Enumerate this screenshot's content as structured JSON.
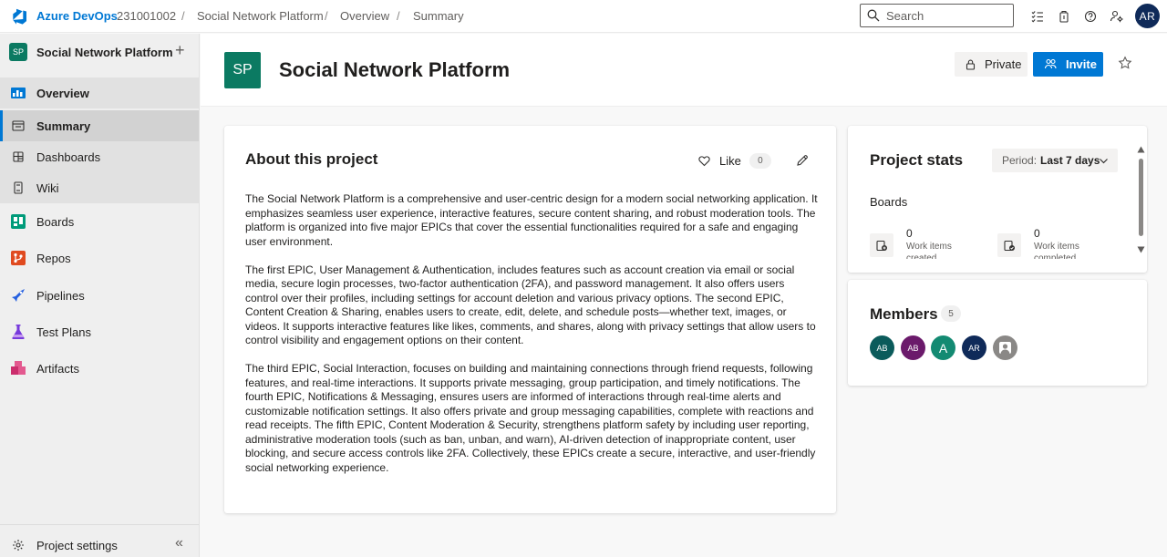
{
  "topbar": {
    "brand": "Azure DevOps",
    "crumbs": [
      "231001002",
      "Social Network Platform",
      "Overview",
      "Summary"
    ],
    "separator": "/",
    "search_placeholder": "Search",
    "user_initials": "AR"
  },
  "sidebar": {
    "project_initials": "SP",
    "project_name": "Social Network Platform",
    "add_symbol": "+",
    "items": [
      {
        "label": "Overview"
      },
      {
        "label": "Summary"
      },
      {
        "label": "Dashboards"
      },
      {
        "label": "Wiki"
      },
      {
        "label": "Boards"
      },
      {
        "label": "Repos"
      },
      {
        "label": "Pipelines"
      },
      {
        "label": "Test Plans"
      },
      {
        "label": "Artifacts"
      }
    ],
    "settings_label": "Project settings",
    "collapse_symbol": "«"
  },
  "header": {
    "initials": "SP",
    "title": "Social Network Platform",
    "private_label": "Private",
    "invite_label": "Invite"
  },
  "about": {
    "title": "About this project",
    "like_label": "Like",
    "like_count": "0",
    "paragraphs": [
      "The Social Network Platform is a comprehensive and user-centric design for a modern social networking application. It emphasizes seamless user experience, interactive features, secure content sharing, and robust moderation tools. The platform is organized into five major EPICs that cover the essential functionalities required for a safe and engaging user environment.",
      "The first EPIC, User Management & Authentication, includes features such as account creation via email or social media, secure login processes, two-factor authentication (2FA), and password management. It also offers users control over their profiles, including settings for account deletion and various privacy options. The second EPIC, Content Creation & Sharing, enables users to create, edit, delete, and schedule posts—whether text, images, or videos. It supports interactive features like likes, comments, and shares, along with privacy settings that allow users to control visibility and engagement options on their content.",
      "The third EPIC, Social Interaction, focuses on building and maintaining connections through friend requests, following features, and real-time interactions. It supports private messaging, group participation, and timely notifications. The fourth EPIC, Notifications & Messaging, ensures users are informed of interactions through real-time alerts and customizable notification settings. It also offers private and group messaging capabilities, complete with reactions and read receipts. The fifth EPIC, Content Moderation & Security, strengthens platform safety by including user reporting, administrative moderation tools (such as ban, unban, and warn), AI-driven detection of inappropriate content, user blocking, and secure access controls like 2FA. Collectively, these EPICs create a secure, interactive, and user-friendly social networking experience."
    ]
  },
  "stats": {
    "title": "Project stats",
    "period_label": "Period:",
    "period_value": "Last 7 days",
    "section": "Boards",
    "items": [
      {
        "value": "0",
        "label": "Work items created"
      },
      {
        "value": "0",
        "label": "Work items completed"
      }
    ]
  },
  "members": {
    "title": "Members",
    "count": "5",
    "avatars": [
      {
        "initials": "AB",
        "color": "#0b5b5b"
      },
      {
        "initials": "AB",
        "color": "#6b1a6b"
      },
      {
        "initials": "A",
        "color": "#138a72"
      },
      {
        "initials": "AR",
        "color": "#0f2a59"
      },
      {
        "initials": "",
        "color": "#8a8886"
      }
    ]
  },
  "colors": {
    "accent": "#0078d4",
    "project_badge": "#0b7a62"
  }
}
